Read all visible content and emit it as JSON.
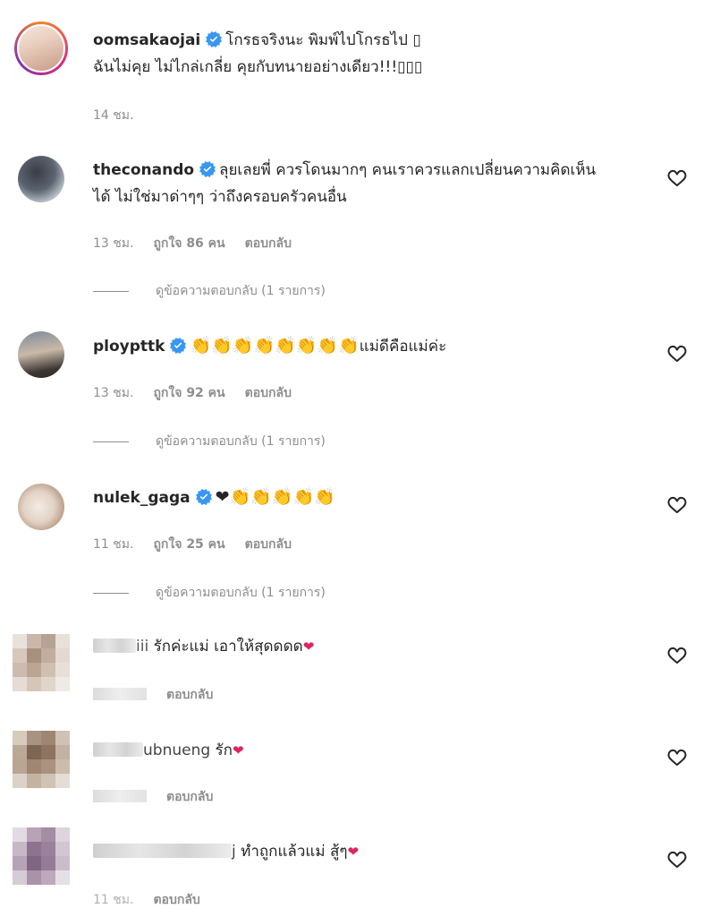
{
  "comments": [
    {
      "username": "oomsakaojai",
      "text1": "โกรธจริงนะ พิมพ์ไปโกรธไป",
      "text1_end": "▯",
      "text2": "ฉันไม่คุย ไม่ไกล่เกลี่ย คุยกับทนายอย่างเดียว!!!",
      "text2_end": "▯▯▯",
      "time": "14 ชม."
    },
    {
      "username": "theconando",
      "text1": "ลุยเลยพี่ ควรโดนมากๆ คนเราควรแลกเปลี่ยนความคิดเห็น",
      "text2": "ได้ ไม่ใช่มาด่าๆๆ ว่าถึงครอบครัวคนอื่น",
      "time": "13 ชม.",
      "likes": "ถูกใจ 86 คน",
      "reply": "ตอบกลับ",
      "view_replies": "ดูข้อความตอบกลับ (1 รายการ)"
    },
    {
      "username": "ploypttk",
      "emojis": "👏👏👏👏👏👏👏👏",
      "text1": "แม่ดีคือแม่ค่ะ",
      "time": "13 ชม.",
      "likes": "ถูกใจ 92 คน",
      "reply": "ตอบกลับ",
      "view_replies": "ดูข้อความตอบกลับ (1 รายการ)"
    },
    {
      "username": "nulek_gaga",
      "emojis": "❤👏👏👏👏👏",
      "time": "11 ชม.",
      "likes": "ถูกใจ 25 คน",
      "reply": "ตอบกลับ",
      "view_replies": "ดูข้อความตอบกลับ (1 รายการ)"
    },
    {
      "username_visible": "iii",
      "text1": "รักค่ะแม่ เอาให้สุดดดด",
      "reply": "ตอบกลับ"
    },
    {
      "username_visible": "ubnueng",
      "text1": "รัก",
      "reply": "ตอบกลับ"
    },
    {
      "username_visible": "j",
      "text1": "ทำถูกแล้วแม่ สู้ๆ",
      "time": "11 ชม.",
      "reply": "ตอบกลับ"
    }
  ],
  "colors": {
    "verified": "#3897f0",
    "meta": "#8e8e8e",
    "text": "#262626",
    "heart_emoji": "#e0245e"
  },
  "icons": {
    "verified": "verified-badge-icon",
    "like": "heart-outline-icon",
    "heart_emoji": "red-heart-emoji"
  }
}
